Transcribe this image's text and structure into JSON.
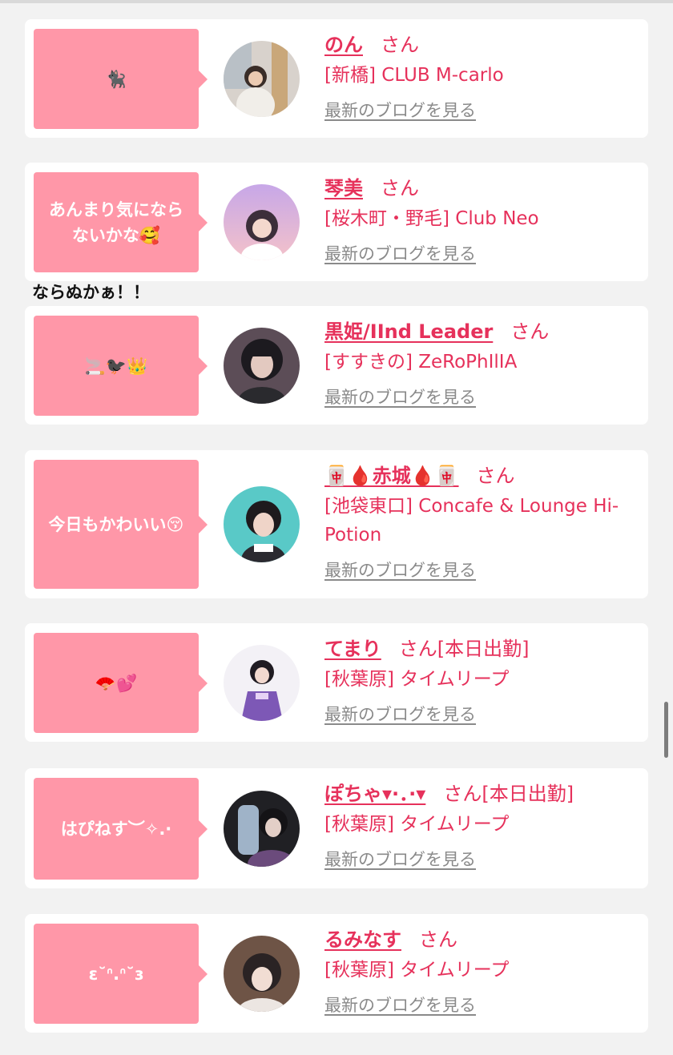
{
  "caption": "ならぬかぁ！！",
  "entries": [
    {
      "bubble": "🐈‍⬛",
      "name": "のん",
      "san": "さん",
      "shop": "[新橋] CLUB M-carlo",
      "blog": "最新のブログを見る"
    },
    {
      "bubble": "あんまり気にならないかな🥰",
      "name": "琴美",
      "san": "さん",
      "shop": "[桜木町・野毛] Club Neo",
      "blog": "最新のブログを見る"
    },
    {
      "bubble": "🚬🐦‍⬛👑",
      "name": "黒姫/IInd Leader",
      "san": "さん",
      "shop": "[すすきの] ZeRoPhIlIA",
      "blog": "最新のブログを見る"
    },
    {
      "bubble": "今日もかわいい😚",
      "name": "🀄🩸赤城🩸🀄",
      "san": "さん",
      "shop": "[池袋東口] Concafe & Lounge Hi-Potion",
      "blog": "最新のブログを見る"
    },
    {
      "bubble": "🪭💕",
      "name": "てまり",
      "san": "さん[本日出勤]",
      "shop": "[秋葉原] タイムリープ",
      "blog": "最新のブログを見る"
    },
    {
      "bubble": "はぴねす︶✧.·",
      "name": "ぽちゃ▾·．·▾",
      "san": "さん[本日出勤]",
      "shop": "[秋葉原] タイムリープ",
      "blog": "最新のブログを見る"
    },
    {
      "bubble": "ɛ˘ᐢ.ᐢ˘ɜ",
      "name": "るみなす",
      "san": "さん",
      "shop": "[秋葉原] タイムリープ",
      "blog": "最新のブログを見る"
    }
  ],
  "colors": {
    "background": "#f2f2f2",
    "card": "#ffffff",
    "bubble": "#ff97a8",
    "accent": "#e6315b",
    "link_gray": "#8a8a8a"
  }
}
